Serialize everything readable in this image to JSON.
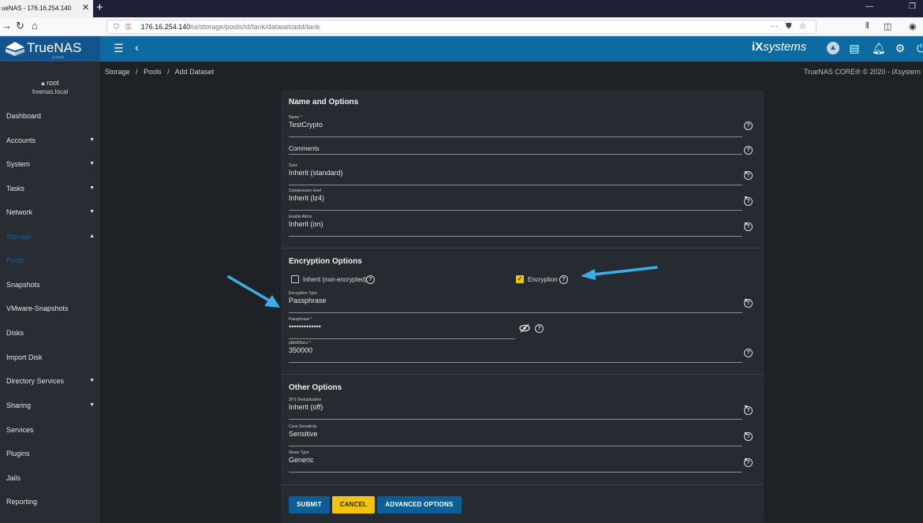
{
  "browser": {
    "tab_title": "ueNAS - 176.16.254.140",
    "url_host": "176.16.254.140",
    "url_path": "/ui/storage/pools/id/tank/dataset/add/tank",
    "url_overflow": "···"
  },
  "header": {
    "logo_text": "TrueNAS",
    "logo_sub": "CORE",
    "vendor": "systems"
  },
  "sidebar": {
    "user": "root",
    "host": "freenas.local",
    "items": [
      {
        "label": "Dashboard"
      },
      {
        "label": "Accounts"
      },
      {
        "label": "System"
      },
      {
        "label": "Tasks"
      },
      {
        "label": "Network"
      },
      {
        "label": "Storage"
      },
      {
        "label": "Pools"
      },
      {
        "label": "Snapshots"
      },
      {
        "label": "VMware-Snapshots"
      },
      {
        "label": "Disks"
      },
      {
        "label": "Import Disk"
      },
      {
        "label": "Directory Services"
      },
      {
        "label": "Sharing"
      },
      {
        "label": "Services"
      },
      {
        "label": "Plugins"
      },
      {
        "label": "Jails"
      },
      {
        "label": "Reporting"
      }
    ]
  },
  "breadcrumb": {
    "storage": "Storage",
    "pools": "Pools",
    "current": "Add Dataset",
    "sep": "/"
  },
  "copyright": "TrueNAS CORE® © 2020 - iXsystem",
  "form": {
    "name_options": {
      "title": "Name and Options",
      "name_label": "Name *",
      "name_value": "TestCrypto",
      "comments_label": "Comments",
      "sync_label": "Sync",
      "sync_value": "Inherit (standard)",
      "compression_label": "Compression level",
      "compression_value": "Inherit (lz4)",
      "atime_label": "Enable Atime",
      "atime_value": "Inherit (on)"
    },
    "encryption": {
      "title": "Encryption Options",
      "inherit_label": "Inherit (non-encrypted)",
      "encryption_label": "Encryption",
      "type_label": "Encryption Type",
      "type_value": "Passphrase",
      "passphrase_label": "Passphrase *",
      "passphrase_value": "•••••••••••••",
      "pbkdf_label": "pbkdf2iters *",
      "pbkdf_value": "350000"
    },
    "other": {
      "title": "Other Options",
      "dedup_label": "ZFS Deduplication",
      "dedup_value": "Inherit (off)",
      "case_label": "Case Sensitivity",
      "case_value": "Sensitive",
      "share_label": "Share Type",
      "share_value": "Generic"
    },
    "buttons": {
      "submit": "SUBMIT",
      "cancel": "CANCEL",
      "advanced": "ADVANCED OPTIONS"
    }
  },
  "colors": {
    "header_blue": "#0e6ba1",
    "accent_yellow": "#f1c40f",
    "annotation_arrow": "#3ab0e8"
  }
}
